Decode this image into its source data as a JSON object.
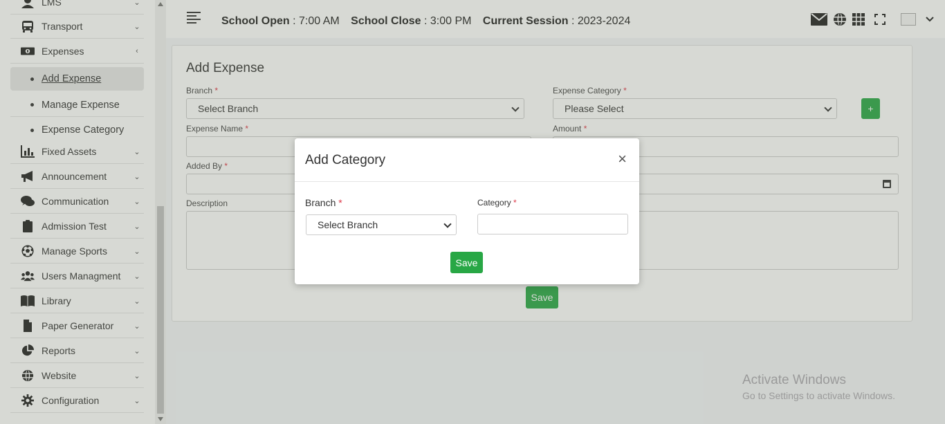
{
  "sidebar": {
    "items": [
      {
        "label": "LMS",
        "icon": "user-graduate-icon"
      },
      {
        "label": "Transport",
        "icon": "bus-icon"
      },
      {
        "label": "Expenses",
        "icon": "money-icon"
      },
      {
        "label": "Fixed Assets",
        "icon": "chart-bar-icon"
      },
      {
        "label": "Announcement",
        "icon": "megaphone-icon"
      },
      {
        "label": "Communication",
        "icon": "comments-icon"
      },
      {
        "label": "Admission Test",
        "icon": "clipboard-icon"
      },
      {
        "label": "Manage Sports",
        "icon": "soccer-ball-icon"
      },
      {
        "label": "Users Managment",
        "icon": "users-icon"
      },
      {
        "label": "Library",
        "icon": "book-icon"
      },
      {
        "label": "Paper Generator",
        "icon": "file-icon"
      },
      {
        "label": "Reports",
        "icon": "pie-chart-icon"
      },
      {
        "label": "Website",
        "icon": "globe-icon"
      },
      {
        "label": "Configuration",
        "icon": "gear-icon"
      }
    ],
    "expenses_sub": [
      {
        "label": "Add Expense"
      },
      {
        "label": "Manage Expense"
      },
      {
        "label": "Expense Category"
      }
    ]
  },
  "topbar": {
    "open_label": "School Open",
    "open_value": ": 7:00 AM",
    "close_label": "School Close",
    "close_value": ": 3:00 PM",
    "session_label": "Current Session",
    "session_value": ": 2023-2024"
  },
  "form": {
    "title": "Add Expense",
    "branch_label": "Branch",
    "branch_value": "Select Branch",
    "category_label": "Expense Category",
    "category_value": "Please Select",
    "plus_label": "+",
    "name_label": "Expense Name",
    "amount_label": "Amount",
    "added_by_label": "Added By",
    "description_label": "Description",
    "save_label": "Save",
    "required_mark": "*"
  },
  "modal": {
    "title": "Add Category",
    "close": "×",
    "branch_label": "Branch",
    "branch_value": "Select Branch",
    "category_label": "Category",
    "save_label": "Save"
  },
  "watermark": {
    "line1": "Activate Windows",
    "line2": "Go to Settings to activate Windows."
  },
  "colors": {
    "accent_green": "#28a745",
    "required_red": "#dc3545"
  }
}
